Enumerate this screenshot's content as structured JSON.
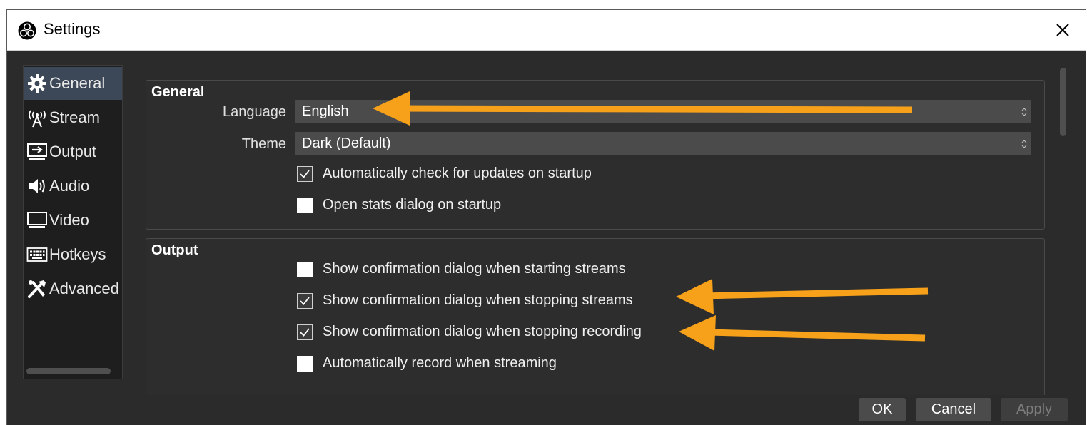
{
  "window": {
    "title": "Settings"
  },
  "sidebar": {
    "items": [
      {
        "label": "General",
        "icon": "gear-icon",
        "active": true
      },
      {
        "label": "Stream",
        "icon": "broadcast-antenna-icon"
      },
      {
        "label": "Output",
        "icon": "output-monitor-icon"
      },
      {
        "label": "Audio",
        "icon": "speaker-icon"
      },
      {
        "label": "Video",
        "icon": "monitor-icon"
      },
      {
        "label": "Hotkeys",
        "icon": "keyboard-icon"
      },
      {
        "label": "Advanced",
        "icon": "tools-icon"
      }
    ]
  },
  "general_group": {
    "title": "General",
    "language": {
      "label": "Language",
      "value": "English"
    },
    "theme": {
      "label": "Theme",
      "value": "Dark (Default)"
    },
    "checkboxes": [
      {
        "label": "Automatically check for updates on startup",
        "checked": true
      },
      {
        "label": "Open stats dialog on startup",
        "checked": false
      }
    ]
  },
  "output_group": {
    "title": "Output",
    "checkboxes": [
      {
        "label": "Show confirmation dialog when starting streams",
        "checked": false
      },
      {
        "label": "Show confirmation dialog when stopping streams",
        "checked": true
      },
      {
        "label": "Show confirmation dialog when stopping recording",
        "checked": true
      },
      {
        "label": "Automatically record when streaming",
        "checked": false
      }
    ]
  },
  "buttons": {
    "ok": "OK",
    "cancel": "Cancel",
    "apply": "Apply"
  },
  "colors": {
    "accent_arrow": "#f7a11a",
    "active_nav": "#3c4858",
    "panel_bg": "#2b2b2b"
  }
}
